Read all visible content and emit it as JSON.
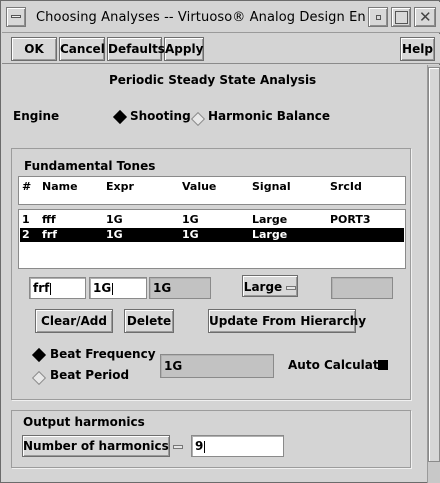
{
  "window": {
    "title": "Choosing Analyses -- Virtuoso® Analog Design Environme"
  },
  "toolbar": {
    "ok": "OK",
    "cancel": "Cancel",
    "defaults": "Defaults",
    "apply": "Apply",
    "help": "Help"
  },
  "analysis": {
    "heading": "Periodic Steady State Analysis",
    "engine_label": "Engine",
    "engine_options": [
      "Shooting",
      "Harmonic Balance"
    ],
    "engine_selected": "Shooting"
  },
  "tones": {
    "group_title": "Fundamental Tones",
    "columns": [
      "#",
      "Name",
      "Expr",
      "Value",
      "Signal",
      "SrcId"
    ],
    "rows": [
      {
        "num": "1",
        "name": "fff",
        "expr": "1G",
        "value": "1G",
        "signal": "Large",
        "srcid": "PORT3",
        "selected": false
      },
      {
        "num": "2",
        "name": "frf",
        "expr": "1G",
        "value": "1G",
        "signal": "Large",
        "srcid": "",
        "selected": true
      }
    ],
    "edit_name": "frf",
    "edit_expr": "1G",
    "edit_value": "1G",
    "edit_signal": "Large",
    "edit_srcid": "",
    "clear_add": "Clear/Add",
    "delete": "Delete",
    "update": "Update From Hierarchy",
    "beat_frequency": "Beat Frequency",
    "beat_period": "Beat Period",
    "beat_selected": "Beat Frequency",
    "beat_value": "1G",
    "auto_calculate": "Auto Calculate",
    "auto_calculate_checked": true
  },
  "output": {
    "group_title": "Output harmonics",
    "mode": "Number of harmonics",
    "harmonics": "9"
  }
}
